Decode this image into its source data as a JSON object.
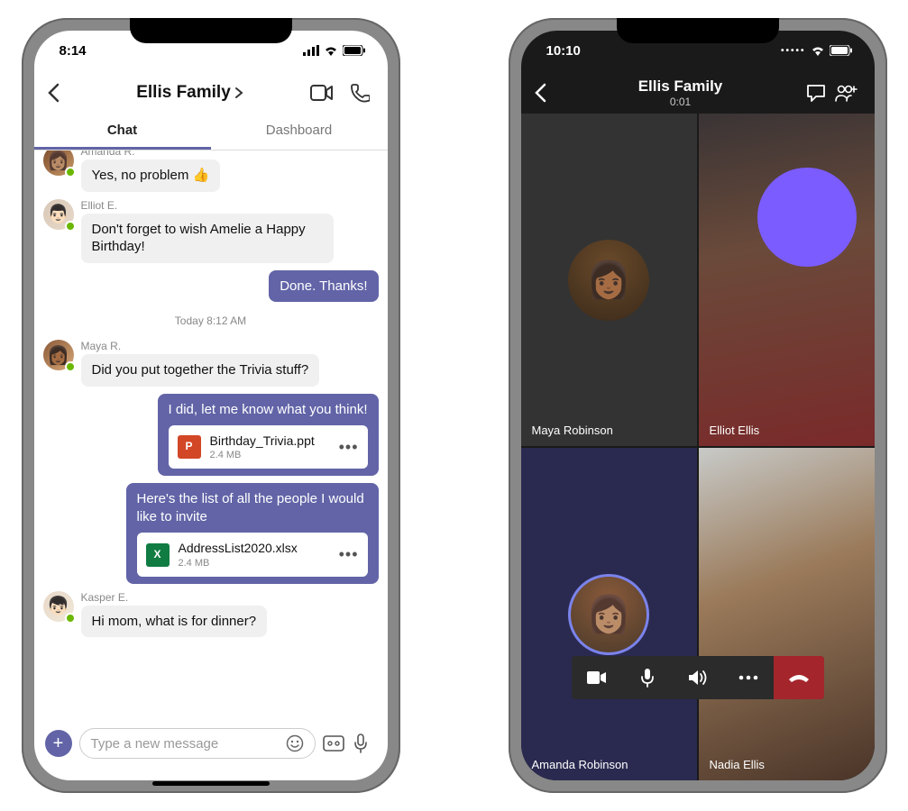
{
  "chat": {
    "status_time": "8:14",
    "header_title": "Ellis Family",
    "tabs": {
      "chat": "Chat",
      "dashboard": "Dashboard"
    },
    "messages": [
      {
        "sender": "Amanda R.",
        "text": "Yes, no problem 👍",
        "dir": "in"
      },
      {
        "sender": "Elliot E.",
        "text": "Don't forget to wish Amelie a Happy Birthday!",
        "dir": "in"
      },
      {
        "text": "Done. Thanks!",
        "dir": "out"
      }
    ],
    "divider": "Today 8:12 AM",
    "messages2": [
      {
        "sender": "Maya R.",
        "text": "Did you put together the Trivia stuff?",
        "dir": "in"
      },
      {
        "text": "I did, let me know what you think!",
        "dir": "out",
        "attachment": {
          "icon": "P",
          "cls": "ppt",
          "name": "Birthday_Trivia.ppt",
          "size": "2.4 MB"
        }
      },
      {
        "text": "Here's the list of all the people I would like to invite",
        "dir": "out",
        "attachment": {
          "icon": "X",
          "cls": "xlsx",
          "name": "AddressList2020.xlsx",
          "size": "2.4 MB"
        }
      },
      {
        "sender": "Kasper E.",
        "text": "Hi mom, what is for dinner?",
        "dir": "in"
      }
    ],
    "composer_placeholder": "Type a new message"
  },
  "call": {
    "status_time": "10:10",
    "header_title": "Ellis Family",
    "timer": "0:01",
    "participants": {
      "tl": "Maya Robinson",
      "tr": "Elliot Ellis",
      "bl": "Amanda Robinson",
      "br": "Nadia Ellis"
    }
  }
}
